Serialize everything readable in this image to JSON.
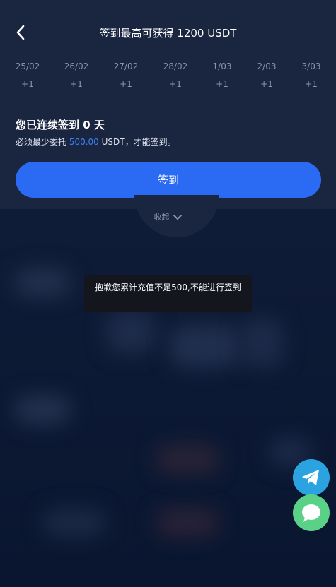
{
  "header": {
    "title": "签到最高可获得 1200 USDT"
  },
  "days": [
    {
      "date": "25/02",
      "reward": "+1"
    },
    {
      "date": "26/02",
      "reward": "+1"
    },
    {
      "date": "27/02",
      "reward": "+1"
    },
    {
      "date": "28/02",
      "reward": "+1"
    },
    {
      "date": "1/03",
      "reward": "+1"
    },
    {
      "date": "2/03",
      "reward": "+1"
    },
    {
      "date": "3/03",
      "reward": "+1"
    }
  ],
  "streak": {
    "text": "您已连续签到 0 天"
  },
  "requirement": {
    "prefix": "必须最少委托 ",
    "amount": "500.00",
    "suffix": " USDT，才能签到。"
  },
  "signin_button": "签到",
  "collapse_label": "收起",
  "toast": "抱歉您累计充值不足500,不能进行签到",
  "icons": {
    "back": "back-arrow-icon",
    "collapse": "chevron-down-icon",
    "telegram": "telegram-icon",
    "chat": "chat-bubble-icon"
  },
  "colors": {
    "accent": "#2b6bf3",
    "amount": "#3b82f6",
    "telegram": "#2aa3e0",
    "chat": "#5ad186"
  }
}
